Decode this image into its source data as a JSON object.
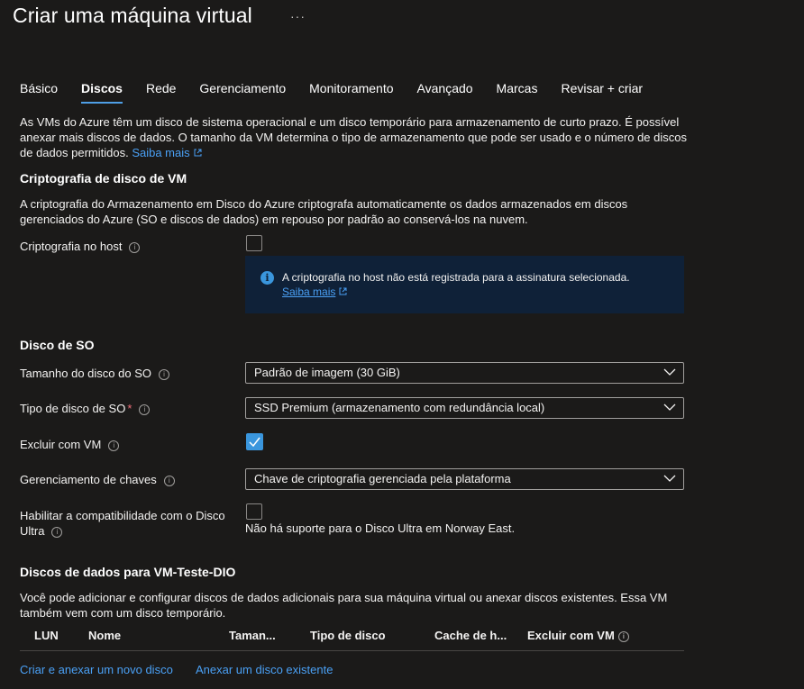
{
  "page": {
    "title": "Criar uma máquina virtual",
    "more": "···"
  },
  "tabs": [
    "Básico",
    "Discos",
    "Rede",
    "Gerenciamento",
    "Monitoramento",
    "Avançado",
    "Marcas",
    "Revisar + criar"
  ],
  "intro": {
    "line1": "As VMs do Azure têm um disco de sistema operacional e um disco temporário para armazenamento de curto prazo. É possível",
    "line2": "anexar mais discos de dados. O tamanho da VM determina o tipo de armazenamento que pode ser usado e o número de discos",
    "line3": "de dados permitidos.",
    "link": "Saiba mais"
  },
  "encryption": {
    "heading": "Criptografia de disco de VM",
    "desc1": "A criptografia do Armazenamento em Disco do Azure criptografa automaticamente os dados armazenados em discos",
    "desc2": "gerenciados do Azure (SO e discos de dados) em repouso por padrão ao conservá-los na nuvem.",
    "host_label": "Criptografia no host",
    "host_checked": false,
    "info_message": "A criptografia no host não está registrada para a assinatura selecionada.",
    "info_link": "Saiba mais"
  },
  "os_disk": {
    "heading": "Disco de SO",
    "size_label": "Tamanho do disco do SO",
    "size_value": "Padrão de imagem (30 GiB)",
    "type_label": "Tipo de disco de SO",
    "type_required": "*",
    "type_value": "SSD Premium (armazenamento com redundância local)",
    "delete_label": "Excluir com VM",
    "delete_checked": true,
    "key_label": "Gerenciamento de chaves",
    "key_value": "Chave de criptografia gerenciada pela plataforma",
    "ultra_label1": "Habilitar a compatibilidade com o Disco",
    "ultra_label2": "Ultra",
    "ultra_checked": false,
    "ultra_note": "Não há suporte para o Disco Ultra em Norway East."
  },
  "data_disks": {
    "heading": "Discos de dados para VM-Teste-DIO",
    "desc1": "Você pode adicionar e configurar discos de dados adicionais para sua máquina virtual ou anexar discos existentes. Essa VM",
    "desc2": "também vem com um disco temporário.",
    "columns": [
      "LUN",
      "Nome",
      "Taman...",
      "Tipo de disco",
      "Cache de h...",
      "Excluir com VM"
    ],
    "create_link": "Criar e anexar um novo disco",
    "attach_link": "Anexar um disco existente"
  },
  "colors": {
    "background": "#1b1a19",
    "accent": "#4aa0f5",
    "info_bg": "#0f2138",
    "checkbox_checked": "#3a96dd"
  },
  "icons": {
    "info": "info-circle-icon",
    "chevron": "chevron-down-icon",
    "external": "external-link-icon"
  }
}
